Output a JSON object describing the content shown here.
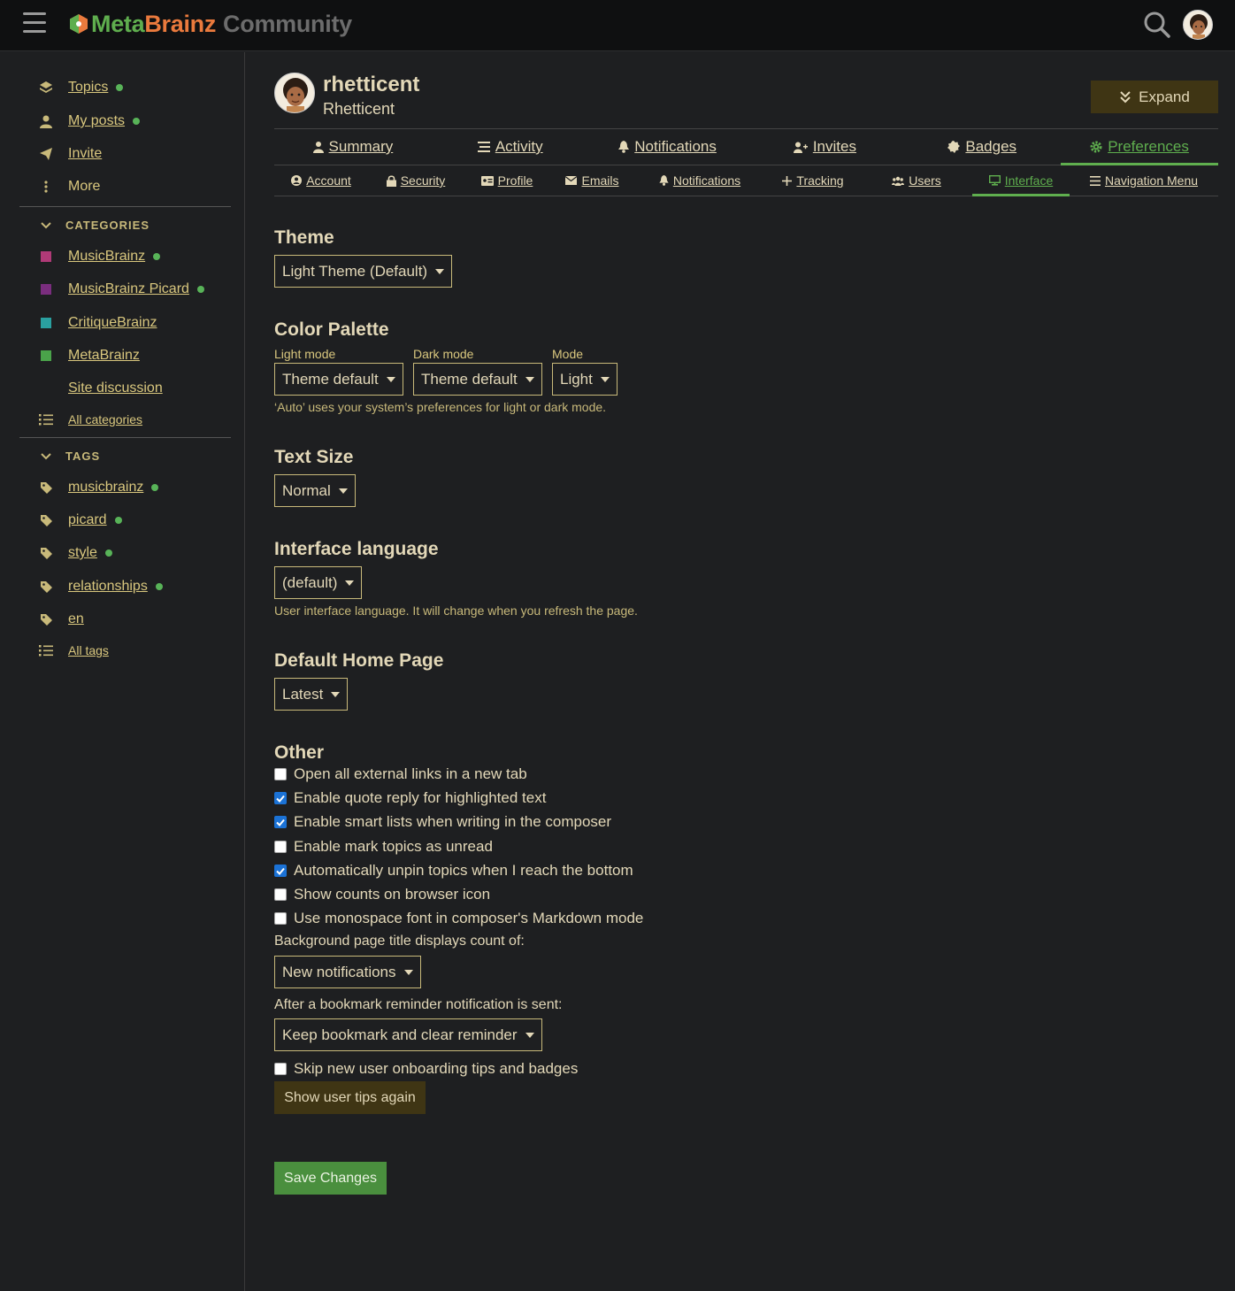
{
  "header": {
    "logo_meta": "MetaBrainz",
    "logo_meta_part": "Meta",
    "logo_brainz_part": "Brainz",
    "logo_community": "Community"
  },
  "sidebar": {
    "items": [
      {
        "label": "Topics"
      },
      {
        "label": "My posts"
      },
      {
        "label": "Invite"
      },
      {
        "label": "More"
      }
    ],
    "categories_heading": "CATEGORIES",
    "categories": [
      {
        "label": "MusicBrainz",
        "color": "#b03a77"
      },
      {
        "label": "MusicBrainz Picard",
        "color": "#7a2d7e"
      },
      {
        "label": "CritiqueBrainz",
        "color": "#2aa0a0"
      },
      {
        "label": "MetaBrainz",
        "color": "#4aa34a"
      },
      {
        "label": "Site discussion",
        "color": "#1e1f21"
      }
    ],
    "all_categories": "All categories",
    "tags_heading": "TAGS",
    "tags": [
      {
        "label": "musicbrainz"
      },
      {
        "label": "picard"
      },
      {
        "label": "style"
      },
      {
        "label": "relationships"
      },
      {
        "label": "en"
      }
    ],
    "all_tags": "All tags"
  },
  "user": {
    "username": "rhetticent",
    "fullname": "Rhetticent",
    "expand_label": "Expand"
  },
  "main_tabs": [
    {
      "label": "Summary"
    },
    {
      "label": "Activity"
    },
    {
      "label": "Notifications"
    },
    {
      "label": "Invites"
    },
    {
      "label": "Badges"
    },
    {
      "label": "Preferences"
    }
  ],
  "sub_tabs": [
    {
      "label": "Account"
    },
    {
      "label": "Security"
    },
    {
      "label": "Profile"
    },
    {
      "label": "Emails"
    },
    {
      "label": "Notifications"
    },
    {
      "label": "Tracking"
    },
    {
      "label": "Users"
    },
    {
      "label": "Interface"
    },
    {
      "label": "Navigation Menu"
    }
  ],
  "theme": {
    "heading": "Theme",
    "value": "Light Theme (Default)"
  },
  "palette": {
    "heading": "Color Palette",
    "light_label": "Light mode",
    "light_value": "Theme default",
    "dark_label": "Dark mode",
    "dark_value": "Theme default",
    "mode_label": "Mode",
    "mode_value": "Light",
    "hint": "‘Auto’ uses your system’s preferences for light or dark mode."
  },
  "text_size": {
    "heading": "Text Size",
    "value": "Normal"
  },
  "language": {
    "heading": "Interface language",
    "value": "(default)",
    "hint": "User interface language. It will change when you refresh the page."
  },
  "home_page": {
    "heading": "Default Home Page",
    "value": "Latest"
  },
  "other": {
    "heading": "Other",
    "checkboxes": [
      {
        "label": "Open all external links in a new tab",
        "checked": false
      },
      {
        "label": "Enable quote reply for highlighted text",
        "checked": true
      },
      {
        "label": "Enable smart lists when writing in the composer",
        "checked": true
      },
      {
        "label": "Enable mark topics as unread",
        "checked": false
      },
      {
        "label": "Automatically unpin topics when I reach the bottom",
        "checked": true
      },
      {
        "label": "Show counts on browser icon",
        "checked": false
      },
      {
        "label": "Use monospace font in composer's Markdown mode",
        "checked": false
      }
    ],
    "title_count_label": "Background page title displays count of:",
    "title_count_value": "New notifications",
    "bookmark_label": "After a bookmark reminder notification is sent:",
    "bookmark_value": "Keep bookmark and clear reminder",
    "skip_tips_label": "Skip new user onboarding tips and badges",
    "skip_tips_checked": false,
    "show_tips_button": "Show user tips again",
    "save_button": "Save Changes"
  }
}
